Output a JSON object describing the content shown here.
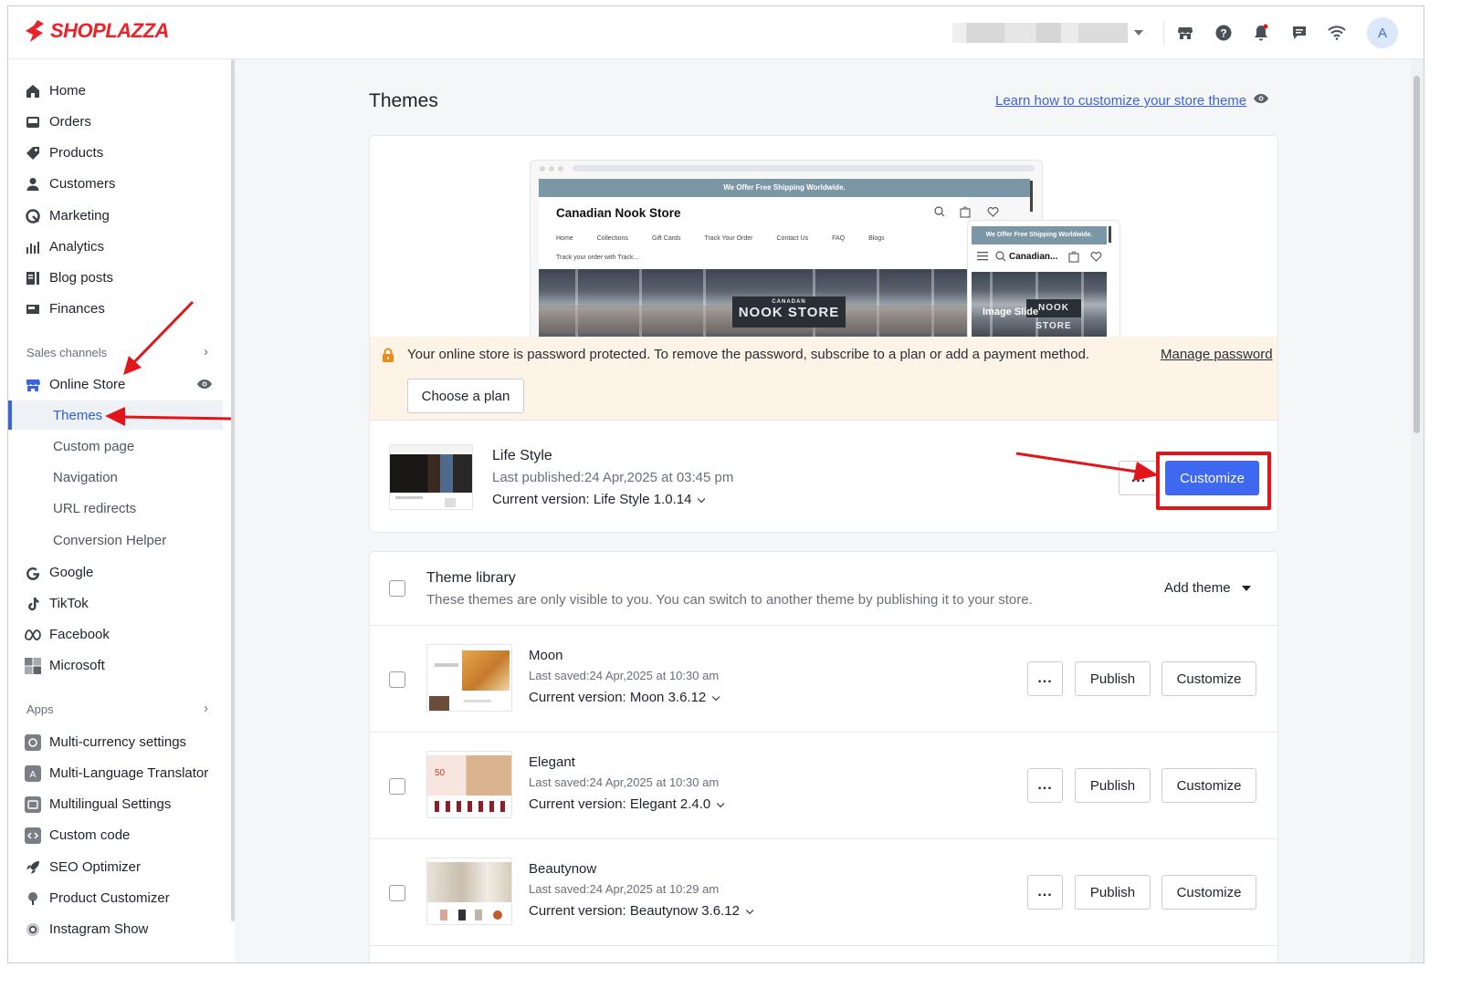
{
  "brand": {
    "name": "SHOPLAZZA",
    "color": "#e8232a"
  },
  "topbar": {
    "icons": [
      "store-icon",
      "help-icon",
      "bell-icon",
      "chat-icon",
      "wifi-icon"
    ],
    "avatar_initial": "A"
  },
  "sidebar": {
    "items": [
      {
        "label": "Home",
        "icon": "home-icon"
      },
      {
        "label": "Orders",
        "icon": "orders-icon"
      },
      {
        "label": "Products",
        "icon": "tag-icon"
      },
      {
        "label": "Customers",
        "icon": "person-icon"
      },
      {
        "label": "Marketing",
        "icon": "marketing-icon"
      },
      {
        "label": "Analytics",
        "icon": "bar-chart-icon"
      },
      {
        "label": "Blog posts",
        "icon": "blog-icon"
      },
      {
        "label": "Finances",
        "icon": "finance-icon"
      }
    ],
    "sales_channels_label": "Sales channels",
    "online_store_label": "Online Store",
    "sub_items": [
      {
        "label": "Themes",
        "active": true
      },
      {
        "label": "Custom page"
      },
      {
        "label": "Navigation"
      },
      {
        "label": "URL redirects"
      },
      {
        "label": "Conversion Helper"
      }
    ],
    "channels": [
      {
        "label": "Google",
        "icon": "google-icon"
      },
      {
        "label": "TikTok",
        "icon": "tiktok-icon"
      },
      {
        "label": "Facebook",
        "icon": "meta-icon"
      },
      {
        "label": "Microsoft",
        "icon": "microsoft-icon"
      }
    ],
    "apps_label": "Apps",
    "apps": [
      {
        "label": "Multi-currency settings"
      },
      {
        "label": "Multi-Language Translator"
      },
      {
        "label": "Multilingual Settings"
      },
      {
        "label": "Custom code"
      },
      {
        "label": "SEO Optimizer"
      },
      {
        "label": "Product Customizer"
      },
      {
        "label": "Instagram Show"
      }
    ]
  },
  "main": {
    "title": "Themes",
    "learn_link": "Learn how to customize your store theme",
    "preview": {
      "banner": "We Offer Free Shipping Worldwide.",
      "store_name": "Canadian Nook Store",
      "store_name_short": "Canadian...",
      "nav": [
        "Home",
        "Collections",
        "Gift Cards",
        "Track Your Order",
        "Contact Us",
        "FAQ",
        "Blogs"
      ],
      "nav_line2": "Track your order with Track...",
      "hero_sign_top": "CANADAN",
      "hero_sign": "NOOK STORE",
      "mobile_caption": "Image Slide"
    },
    "alert": {
      "text": "Your online store is password protected. To remove the password, subscribe to a plan or add a payment method.",
      "link": "Manage password",
      "button": "Choose a plan"
    },
    "current_theme": {
      "name": "Life Style",
      "published": "Last published:24 Apr,2025 at 03:45 pm",
      "version": "Current version: Life Style 1.0.14",
      "customize": "Customize",
      "more": "..."
    },
    "library": {
      "title": "Theme library",
      "description": "These themes are only visible to you. You can switch to another theme by publishing it to your store.",
      "add_theme": "Add theme",
      "themes": [
        {
          "name": "Moon",
          "saved": "Last saved:24 Apr,2025 at 10:30 am",
          "version": "Current version: Moon 3.6.12"
        },
        {
          "name": "Elegant",
          "saved": "Last saved:24 Apr,2025 at 10:30 am",
          "version": "Current version: Elegant 2.4.0"
        },
        {
          "name": "Beautynow",
          "saved": "Last saved:24 Apr,2025 at 10:29 am",
          "version": "Current version: Beautynow 3.6.12"
        }
      ],
      "more_label": "...",
      "publish_label": "Publish",
      "customize_label": "Customize"
    }
  },
  "colors": {
    "accent": "#3d68ef",
    "annotation": "#e0161b",
    "alert_bg": "#fdf3e7"
  }
}
